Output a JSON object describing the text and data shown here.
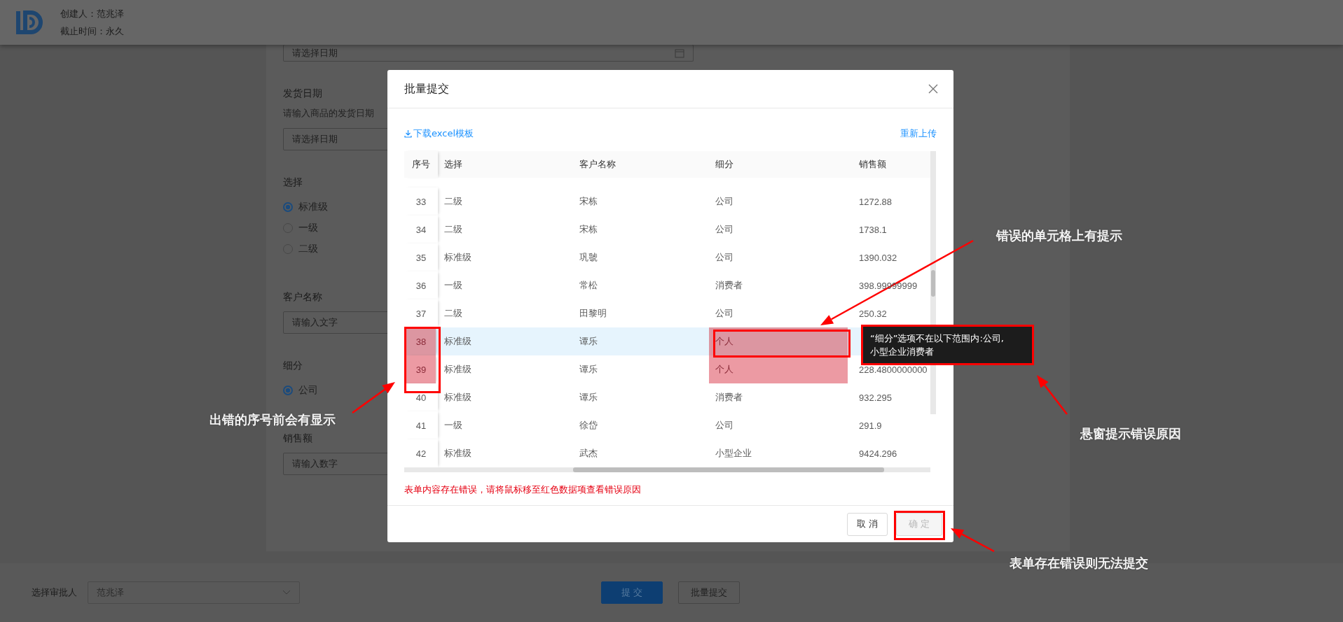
{
  "header": {
    "creator": "创建人：范兆泽",
    "deadline": "截止时间：永久"
  },
  "form": {
    "fields": [
      {
        "kind": "date",
        "placeholder": "请选择日期"
      },
      {
        "kind": "date",
        "label": "发货日期",
        "hint": "请输入商品的发货日期",
        "placeholder": "请选择日期"
      },
      {
        "kind": "radio",
        "label": "选择",
        "options": [
          {
            "label": "标准级",
            "selected": true
          },
          {
            "label": "一级",
            "selected": false
          },
          {
            "label": "二级",
            "selected": false
          }
        ]
      },
      {
        "kind": "text",
        "label": "客户名称",
        "placeholder": "请输入文字"
      },
      {
        "kind": "radio",
        "label": "细分",
        "options": [
          {
            "label": "公司",
            "selected": true
          }
        ]
      },
      {
        "kind": "text",
        "label": "销售额",
        "placeholder": "请输入数字"
      }
    ]
  },
  "footer": {
    "approver_label": "选择审批人",
    "approver_value": "范兆泽",
    "buttons": [
      {
        "label": "提 交",
        "kind": "primary"
      },
      {
        "label": "批量提交",
        "kind": "default"
      }
    ]
  },
  "modal": {
    "title": "批量提交",
    "download_link": "下载excel模板",
    "reupload_link": "重新上传",
    "table": {
      "columns": [
        "序号",
        "选择",
        "客户名称",
        "细分",
        "销售额"
      ],
      "rows": [
        {
          "index": "33",
          "grade": "二级",
          "customer": "宋栋",
          "segment": "公司",
          "sales": "1272.88",
          "segment_invalid": false,
          "hovered": false
        },
        {
          "index": "34",
          "grade": "二级",
          "customer": "宋栋",
          "segment": "公司",
          "sales": "1738.1",
          "segment_invalid": false,
          "hovered": false
        },
        {
          "index": "35",
          "grade": "标准级",
          "customer": "巩虢",
          "segment": "公司",
          "sales": "1390.032",
          "segment_invalid": false,
          "hovered": false
        },
        {
          "index": "36",
          "grade": "一级",
          "customer": "常松",
          "segment": "消费者",
          "sales": "398.99999999",
          "segment_invalid": false,
          "hovered": false
        },
        {
          "index": "37",
          "grade": "二级",
          "customer": "田黎明",
          "segment": "公司",
          "sales": "250.32",
          "segment_invalid": false,
          "hovered": false
        },
        {
          "index": "38",
          "grade": "标准级",
          "customer": "谭乐",
          "segment": "个人",
          "segment_invalid": true,
          "hovered": true
        },
        {
          "index": "39",
          "grade": "标准级",
          "customer": "谭乐",
          "segment": "个人",
          "sales": "228.4800000000",
          "segment_invalid": true,
          "hovered": false
        },
        {
          "index": "40",
          "grade": "标准级",
          "customer": "谭乐",
          "segment": "消费者",
          "sales": "932.295",
          "segment_invalid": false,
          "hovered": false
        },
        {
          "index": "41",
          "grade": "一级",
          "customer": "徐岱",
          "segment": "公司",
          "sales": "291.9",
          "segment_invalid": false,
          "hovered": false
        },
        {
          "index": "42",
          "grade": "标准级",
          "customer": "武杰",
          "segment": "小型企业",
          "sales": "9424.296",
          "segment_invalid": false,
          "hovered": false
        }
      ]
    },
    "error_message": "表单内容存在错误，请将鼠标移至红色数据项查看错误原因",
    "buttons": [
      {
        "label": "取 消",
        "disabled": false
      },
      {
        "label": "确 定",
        "disabled": true
      }
    ]
  },
  "tooltip": {
    "text": "“细分”选项不在以下范围内:公司,小型企业消费者"
  },
  "annotations": [
    {
      "text": "错误的单元格上有提示"
    },
    {
      "text": "出错的序号前会有显示"
    },
    {
      "text": "悬窗提示错误原因"
    },
    {
      "text": "表单存在错误则无法提交"
    }
  ]
}
